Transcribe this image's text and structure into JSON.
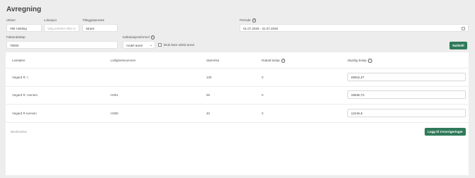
{
  "page": {
    "title": "Avregning"
  },
  "form": {
    "utleier": {
      "label": "Utleier",
      "value": "VBI Holding"
    },
    "lokasjon": {
      "label": "Lokasjon",
      "placeholder": "Velg enheter eller lo"
    },
    "tilleggstjeneste": {
      "label": "Tilleggstjeneste",
      "value": "Strøm"
    },
    "periode": {
      "label": "Periode",
      "value": "01.07.2025 - 31.07.2025"
    },
    "fakturabelop": {
      "label": "Fakturabeløp",
      "value": "75000"
    },
    "kalkulasjonsformel": {
      "label": "Kalkulasjonsformel",
      "value": "Andel areal"
    },
    "only_active_checkbox": {
      "label": "Bruk bare utleid areal"
    },
    "nullstill_label": "Nullstill"
  },
  "table": {
    "columns": {
      "leietaker": "Leietaker",
      "leilighetsnummer": "Leilighetsnummer",
      "storrelse": "Størrelse",
      "rabatt": "Rabatt beløp",
      "skyldig": "Skyldig beløp"
    },
    "rows": [
      {
        "leietaker": "Vegard R. I.",
        "leilighetsnummer": "",
        "storrelse": "100",
        "rabatt": "0",
        "skyldig": "46916,37"
      },
      {
        "leietaker": "Vegard R. Iversen",
        "leilighetsnummer": "H301",
        "storrelse": "55",
        "rabatt": "0",
        "skyldig": "15836,73"
      },
      {
        "leietaker": "Vegard R Iversen",
        "leilighetsnummer": "H305",
        "storrelse": "40",
        "rabatt": "0",
        "skyldig": "12246,9"
      }
    ],
    "footer": {
      "description_placeholder": "Beskrivelse",
      "add_button_label": "Legg til 3 Korrigeringer"
    }
  }
}
